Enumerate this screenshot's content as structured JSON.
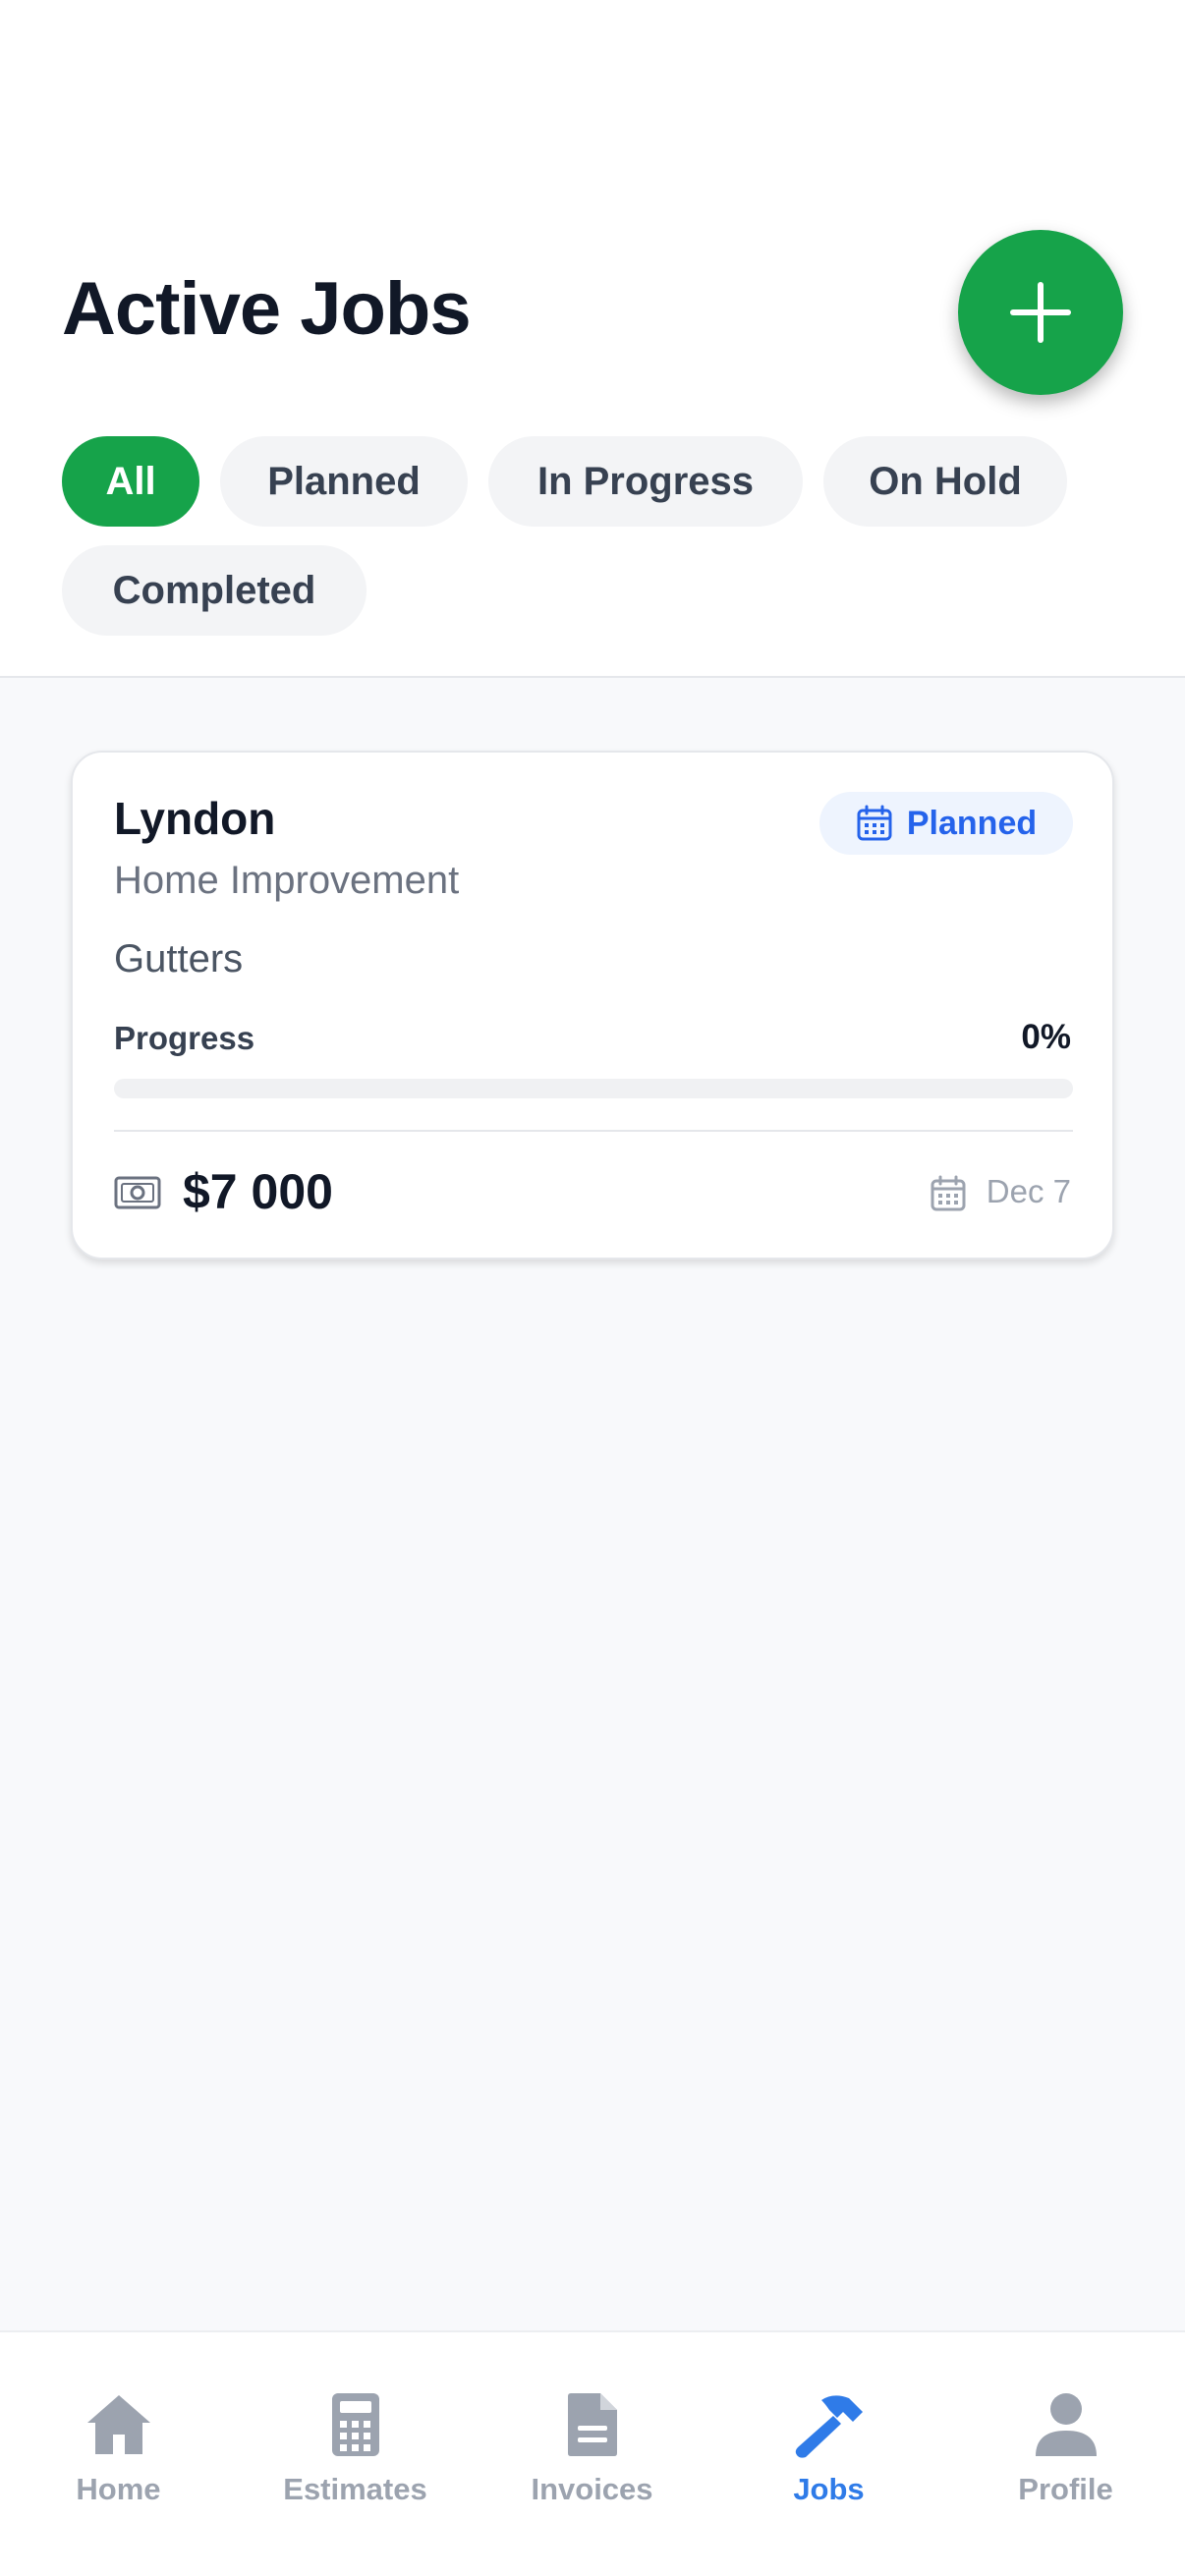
{
  "header": {
    "title": "Active Jobs"
  },
  "filters": [
    {
      "label": "All",
      "active": true
    },
    {
      "label": "Planned",
      "active": false
    },
    {
      "label": "In Progress",
      "active": false
    },
    {
      "label": "On Hold",
      "active": false
    },
    {
      "label": "Completed",
      "active": false
    }
  ],
  "jobs": [
    {
      "client": "Lyndon",
      "category": "Home Improvement",
      "description": "Gutters",
      "status": "Planned",
      "progress_label": "Progress",
      "progress_text": "0%",
      "progress_fraction": 0,
      "amount": "$7 000",
      "date": "Dec 7"
    }
  ],
  "tabbar": {
    "items": [
      {
        "label": "Home",
        "icon": "home-icon",
        "active": false
      },
      {
        "label": "Estimates",
        "icon": "calculator-icon",
        "active": false
      },
      {
        "label": "Invoices",
        "icon": "document-icon",
        "active": false
      },
      {
        "label": "Jobs",
        "icon": "hammer-icon",
        "active": true
      },
      {
        "label": "Profile",
        "icon": "person-icon",
        "active": false
      }
    ]
  },
  "colors": {
    "primary_green": "#16a34a",
    "active_tab_blue": "#2f7be8",
    "status_blue": "#2563eb",
    "inactive_gray": "#9ca3af"
  }
}
